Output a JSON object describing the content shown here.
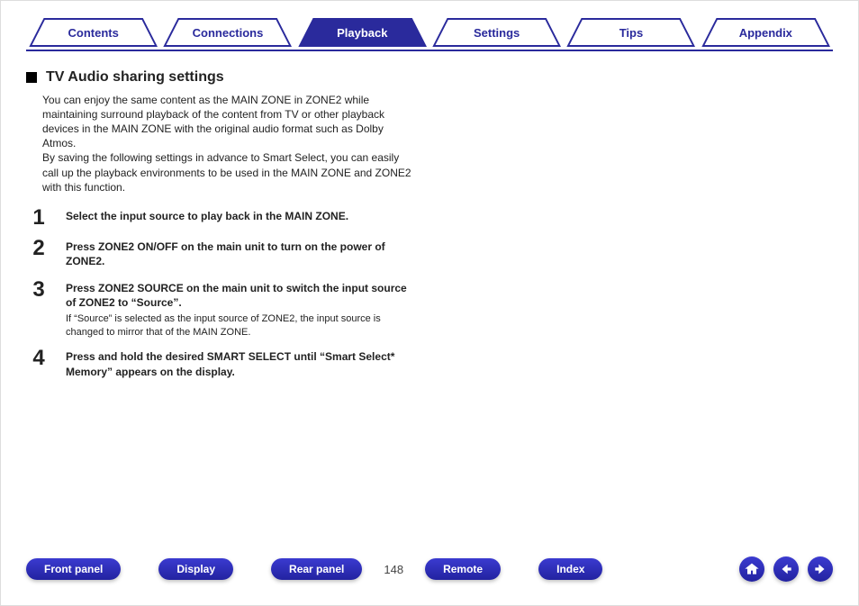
{
  "tabs": [
    {
      "label": "Contents",
      "active": false
    },
    {
      "label": "Connections",
      "active": false
    },
    {
      "label": "Playback",
      "active": true
    },
    {
      "label": "Settings",
      "active": false
    },
    {
      "label": "Tips",
      "active": false
    },
    {
      "label": "Appendix",
      "active": false
    }
  ],
  "section": {
    "title": "TV Audio sharing settings",
    "intro": "You can enjoy the same content as the MAIN ZONE in ZONE2 while maintaining surround playback of the content from TV or other playback devices in the MAIN ZONE with the original audio format such as Dolby Atmos.\nBy saving the following settings in advance to Smart Select, you can easily call up the playback environments to be used in the MAIN ZONE and ZONE2 with this function."
  },
  "steps": [
    {
      "num": "1",
      "title": "Select the input source to play back in the MAIN ZONE.",
      "note": ""
    },
    {
      "num": "2",
      "title": "Press ZONE2 ON/OFF on the main unit to turn on the power of ZONE2.",
      "note": ""
    },
    {
      "num": "3",
      "title": "Press ZONE2 SOURCE on the main unit to switch the input source of ZONE2 to “Source”.",
      "note": "If “Source” is selected as the input source of ZONE2, the input source is changed to mirror that of the MAIN ZONE."
    },
    {
      "num": "4",
      "title": "Press and hold the desired SMART SELECT until “Smart Select* Memory” appears on the display.",
      "note": ""
    }
  ],
  "bottom": {
    "front_panel": "Front panel",
    "display": "Display",
    "rear_panel": "Rear panel",
    "page_number": "148",
    "remote": "Remote",
    "index": "Index"
  },
  "icons": {
    "home": "home-icon",
    "prev": "arrow-left-icon",
    "next": "arrow-right-icon"
  },
  "colors": {
    "brand_blue": "#2a2a9c"
  }
}
